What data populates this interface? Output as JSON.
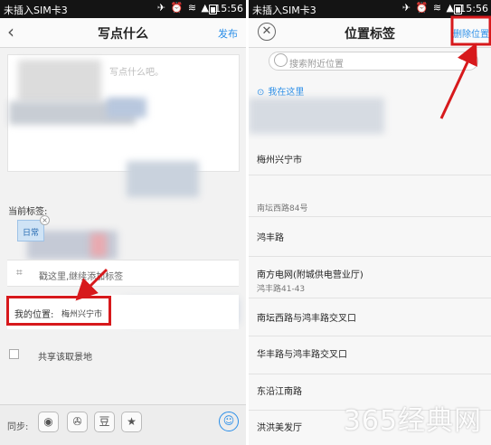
{
  "left_screen": {
    "status": {
      "carrier": "未插入SIM卡3",
      "time": "15:56"
    },
    "header": {
      "title": "写点什么",
      "publish": "发布"
    },
    "compose": {
      "placeholder": "写点什么吧。"
    },
    "tags": {
      "label": "当前标签:",
      "chip": "日常",
      "remove_glyph": "×",
      "input_hint": "戳这里,继续添加标签"
    },
    "location": {
      "label": "我的位置:",
      "value": "梅州兴宁市"
    },
    "share": {
      "label": "共享该取景地"
    },
    "sync": {
      "label": "同步:",
      "buttons": [
        "◉",
        "✇",
        "豆",
        "★"
      ],
      "emoji": "☺"
    }
  },
  "right_screen": {
    "status": {
      "carrier": "未插入SIM卡3",
      "time": "15:56"
    },
    "header": {
      "title": "位置标签",
      "delete": "删除位置"
    },
    "search": {
      "placeholder": "搜索附近位置"
    },
    "current": {
      "label": "我在这里"
    },
    "places": [
      {
        "name": "梅州兴宁市",
        "addr": ""
      },
      {
        "name": "",
        "addr": "南坛西路84号"
      },
      {
        "name": "鸿丰路",
        "addr": ""
      },
      {
        "name": "南方电网(附城供电营业厅)",
        "addr": "鸿丰路41-43"
      },
      {
        "name": "南坛西路与鸿丰路交叉口",
        "addr": ""
      },
      {
        "name": "华丰路与鸿丰路交叉口",
        "addr": ""
      },
      {
        "name": "东沿江南路",
        "addr": ""
      },
      {
        "name": "洪洪美发厅",
        "addr": ""
      }
    ]
  },
  "watermark": "365经典网",
  "colors": {
    "accent": "#2a8ee8",
    "highlight": "#d7191c",
    "statusbar": "#141414"
  }
}
